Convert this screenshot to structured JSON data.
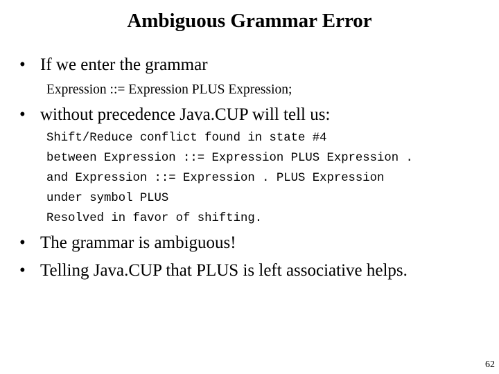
{
  "slide": {
    "title": "Ambiguous Grammar Error",
    "bullets": [
      "If we enter the grammar",
      "without precedence Java.CUP will tell us:",
      "The grammar is ambiguous!",
      "Telling Java.CUP that PLUS is left associative helps."
    ],
    "bullet_symbol": "•",
    "grammar_line": "Expression ::= Expression PLUS Expression;",
    "conflict_output": [
      "Shift/Reduce conflict found in state #4",
      "between Expression ::= Expression PLUS Expression .",
      "and Expression ::= Expression . PLUS Expression",
      "under symbol PLUS",
      "Resolved in favor of shifting."
    ],
    "page_number": "62"
  }
}
